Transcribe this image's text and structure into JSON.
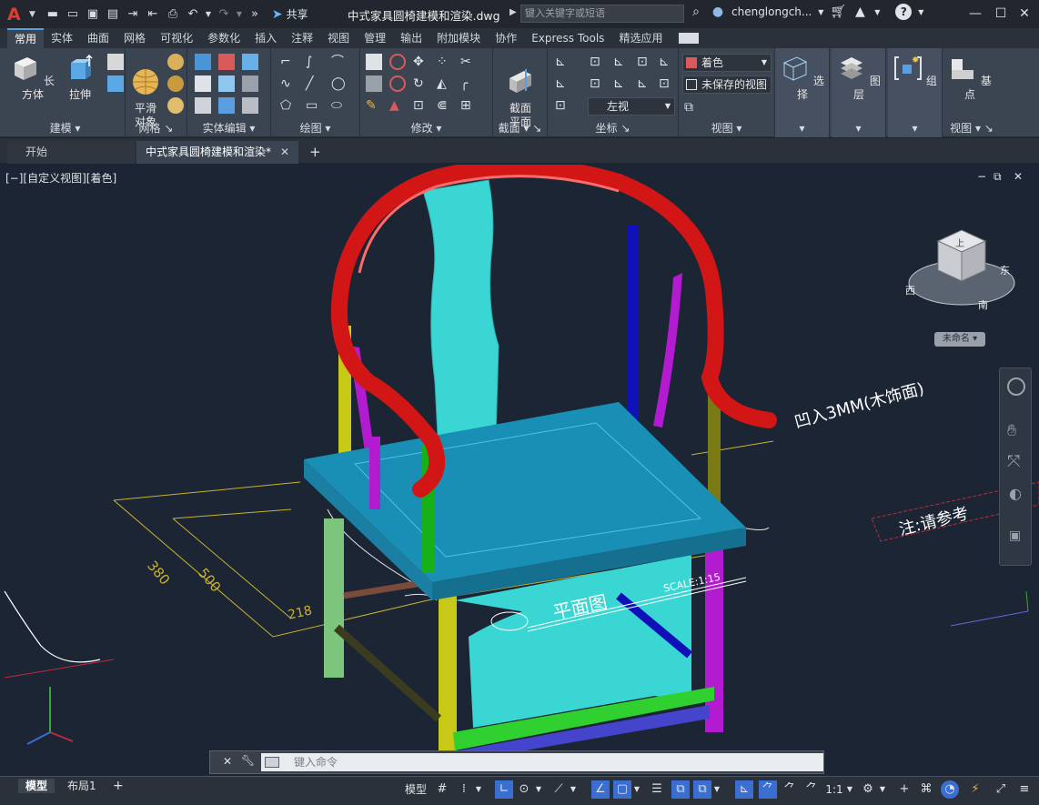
{
  "app": {
    "logo": "A",
    "share_label": "共享",
    "document_title": "中式家具圆椅建模和渲染.dwg",
    "search_placeholder": "键入关键字或短语",
    "username": "chenglongch...",
    "help_label": "?"
  },
  "ribbon_tabs": [
    "常用",
    "实体",
    "曲面",
    "网格",
    "可视化",
    "参数化",
    "插入",
    "注释",
    "视图",
    "管理",
    "输出",
    "附加模块",
    "协作",
    "Express Tools",
    "精选应用"
  ],
  "active_ribbon_tab": "常用",
  "ribbon": {
    "panels": [
      {
        "title": "建模",
        "buttons": [
          "长方体",
          "拉伸"
        ]
      },
      {
        "title": "网格",
        "buttons": [
          "平滑\n对象"
        ]
      },
      {
        "title": "实体编辑"
      },
      {
        "title": "绘图"
      },
      {
        "title": "修改"
      },
      {
        "title": "截面",
        "buttons": [
          "截面\n平面"
        ]
      },
      {
        "title": "坐标"
      },
      {
        "title": "视图"
      },
      {
        "title": "",
        "buttons": [
          "选择"
        ]
      },
      {
        "title": "",
        "buttons": [
          "图层"
        ]
      },
      {
        "title": "",
        "buttons": [
          "组"
        ]
      },
      {
        "title": "视图",
        "buttons": [
          "基点"
        ]
      }
    ],
    "visual_style_combo": "着色",
    "named_view_combo": "未保存的视图",
    "view_combo": "左视"
  },
  "doc_tabs": [
    {
      "label": "开始"
    },
    {
      "label": "中式家具圆椅建模和渲染*"
    }
  ],
  "viewport": {
    "label": "[−][自定义视图][着色]",
    "viewcube_labels": {
      "top": "上",
      "west": "西",
      "south": "南",
      "east": "东"
    },
    "wcs_label": "未命名",
    "annotations": {
      "note_recess": "凹入3MM(木饰面)",
      "note_refer": "注:请参考",
      "plan_title": "平面图",
      "scale": "SCALE:1:15",
      "dim_a": "380",
      "dim_b": "500",
      "dim_c": "218"
    }
  },
  "command_line": {
    "placeholder": "键入命令"
  },
  "status": {
    "layout_tabs": [
      "模型",
      "布局1"
    ],
    "model_label": "模型",
    "scale_label": "1:1"
  },
  "colors": {
    "accent": "#5a9ee0",
    "background": "#1b2534",
    "ribbon": "#3b4451"
  }
}
